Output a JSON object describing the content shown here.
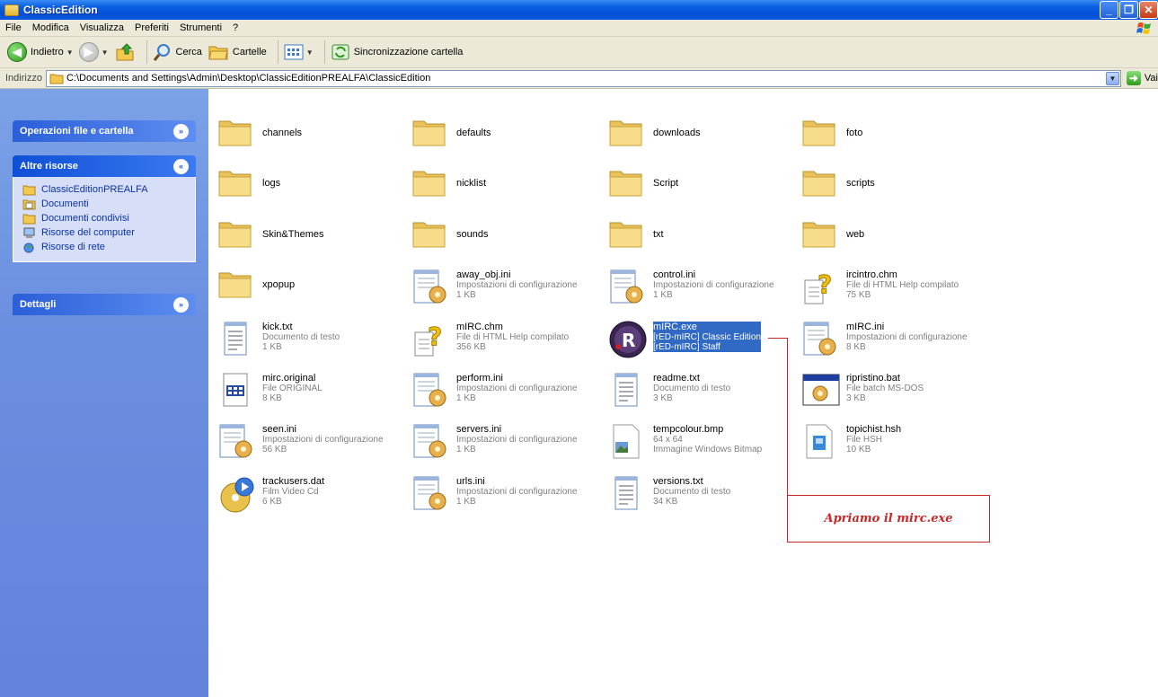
{
  "window": {
    "title": "ClassicEdition",
    "buttons": {
      "minimize": "_",
      "maximize": "❐",
      "close": "✕"
    }
  },
  "menu": [
    "File",
    "Modifica",
    "Visualizza",
    "Preferiti",
    "Strumenti",
    "?"
  ],
  "toolbar": {
    "back": "Indietro",
    "search": "Cerca",
    "folders": "Cartelle",
    "sync": "Sincronizzazione cartella"
  },
  "address": {
    "label": "Indirizzo",
    "path": "C:\\Documents and Settings\\Admin\\Desktop\\ClassicEditionPREALFA\\ClassicEdition",
    "go": "Vai"
  },
  "taskpane": {
    "panel1": "Operazioni file e cartella",
    "panel2": "Altre risorse",
    "links": [
      "ClassicEditionPREALFA",
      "Documenti",
      "Documenti condivisi",
      "Risorse del computer",
      "Risorse di rete"
    ],
    "panel3": "Dettagli"
  },
  "files": [
    {
      "name": "channels",
      "kind": "folder"
    },
    {
      "name": "defaults",
      "kind": "folder"
    },
    {
      "name": "downloads",
      "kind": "folder"
    },
    {
      "name": "foto",
      "kind": "folder"
    },
    {
      "name": "logs",
      "kind": "folder"
    },
    {
      "name": "nicklist",
      "kind": "folder"
    },
    {
      "name": "Script",
      "kind": "folder"
    },
    {
      "name": "scripts",
      "kind": "folder"
    },
    {
      "name": "Skin&Themes",
      "kind": "folder"
    },
    {
      "name": "sounds",
      "kind": "folder"
    },
    {
      "name": "txt",
      "kind": "folder"
    },
    {
      "name": "web",
      "kind": "folder"
    },
    {
      "name": "xpopup",
      "kind": "folder"
    },
    {
      "name": "away_obj.ini",
      "type": "Impostazioni di configurazione",
      "size": "1 KB",
      "kind": "ini"
    },
    {
      "name": "control.ini",
      "type": "Impostazioni di configurazione",
      "size": "1 KB",
      "kind": "ini"
    },
    {
      "name": "ircintro.chm",
      "type": "File di HTML Help compilato",
      "size": "75 KB",
      "kind": "chm"
    },
    {
      "name": "kick.txt",
      "type": "Documento di testo",
      "size": "1 KB",
      "kind": "txt"
    },
    {
      "name": "mIRC.chm",
      "type": "File di HTML Help compilato",
      "size": "356 KB",
      "kind": "chm"
    },
    {
      "name": "mIRC.exe",
      "type": "[rED-mIRC] Classic Edition",
      "size": "[rED-mIRC] Staff",
      "kind": "exe",
      "selected": true
    },
    {
      "name": "mIRC.ini",
      "type": "Impostazioni di configurazione",
      "size": "8 KB",
      "kind": "ini"
    },
    {
      "name": "mirc.original",
      "type": "File ORIGINAL",
      "size": "8 KB",
      "kind": "original"
    },
    {
      "name": "perform.ini",
      "type": "Impostazioni di configurazione",
      "size": "1 KB",
      "kind": "ini"
    },
    {
      "name": "readme.txt",
      "type": "Documento di testo",
      "size": "3 KB",
      "kind": "txt"
    },
    {
      "name": "ripristino.bat",
      "type": "File batch MS-DOS",
      "size": "3 KB",
      "kind": "bat"
    },
    {
      "name": "seen.ini",
      "type": "Impostazioni di configurazione",
      "size": "56 KB",
      "kind": "ini"
    },
    {
      "name": "servers.ini",
      "type": "Impostazioni di configurazione",
      "size": "1 KB",
      "kind": "ini"
    },
    {
      "name": "tempcolour.bmp",
      "type": "64 x 64",
      "size": "Immagine Windows Bitmap",
      "kind": "bmp"
    },
    {
      "name": "topichist.hsh",
      "type": "File HSH",
      "size": "10 KB",
      "kind": "hsh"
    },
    {
      "name": "trackusers.dat",
      "type": "Film Video Cd",
      "size": "6 KB",
      "kind": "dat"
    },
    {
      "name": "urls.ini",
      "type": "Impostazioni di configurazione",
      "size": "1 KB",
      "kind": "ini"
    },
    {
      "name": "versions.txt",
      "type": "Documento di testo",
      "size": "34 KB",
      "kind": "txt"
    }
  ],
  "annotation": "Apriamo il mirc.exe",
  "colors": {
    "titlebar": "#0450d6",
    "taskpane": "#6b8fe0",
    "selection": "#316ac5",
    "annotation": "#c62828"
  }
}
